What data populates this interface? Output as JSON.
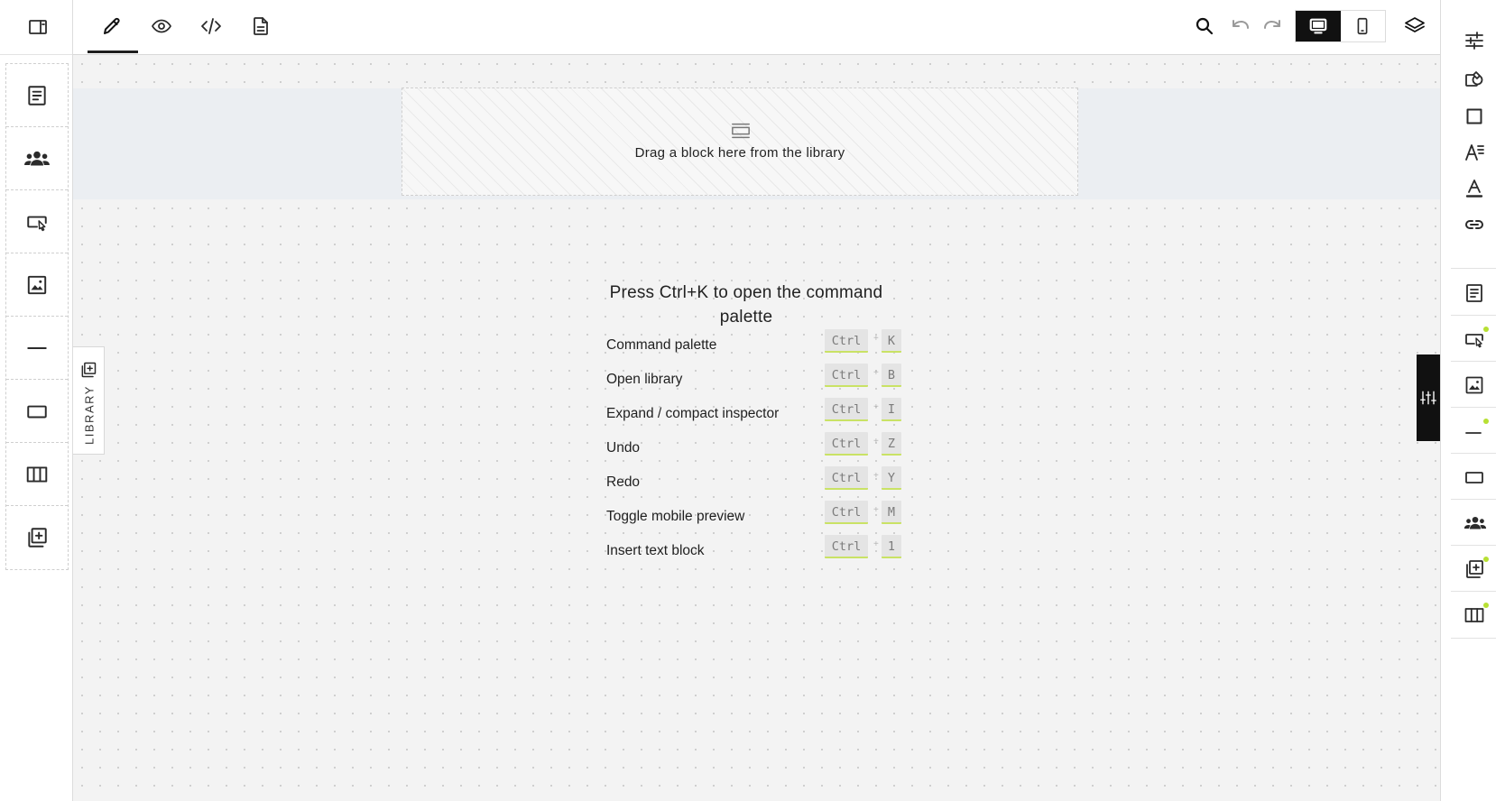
{
  "toolbar": {
    "tabs": [
      {
        "id": "edit",
        "icon": "pencil-icon",
        "active": true
      },
      {
        "id": "preview",
        "icon": "eye-icon",
        "active": false
      },
      {
        "id": "code",
        "icon": "code-icon",
        "active": false
      },
      {
        "id": "document",
        "icon": "document-icon",
        "active": false
      }
    ],
    "tools": [
      "search-icon",
      "undo-icon",
      "redo-icon"
    ],
    "device_modes": [
      {
        "id": "desktop",
        "icon": "desktop-icon",
        "active": true
      },
      {
        "id": "mobile",
        "icon": "mobile-icon",
        "active": false
      }
    ],
    "layers_icon": "layers-icon"
  },
  "left_sidebar": {
    "toggle_icon": "sidebar-panel-icon",
    "blocks": [
      "text-block-icon",
      "group-block-icon",
      "button-block-icon",
      "image-block-icon",
      "divider-block-icon",
      "container-block-icon",
      "columns-block-icon",
      "add-block-icon"
    ]
  },
  "canvas": {
    "drop_zone_text": "Drag a block here from the library",
    "library_label": "LIBRARY"
  },
  "shortcuts": {
    "title": "Press Ctrl+K to open the command palette",
    "plus": "+",
    "items": [
      {
        "label": "Command palette",
        "modifier": "Ctrl",
        "key": "K"
      },
      {
        "label": "Open library",
        "modifier": "Ctrl",
        "key": "B"
      },
      {
        "label": "Expand / compact inspector",
        "modifier": "Ctrl",
        "key": "I"
      },
      {
        "label": "Undo",
        "modifier": "Ctrl",
        "key": "Z"
      },
      {
        "label": "Redo",
        "modifier": "Ctrl",
        "key": "Y"
      },
      {
        "label": "Toggle mobile preview",
        "modifier": "Ctrl",
        "key": "M"
      },
      {
        "label": "Insert text block",
        "modifier": "Ctrl",
        "key": "1"
      }
    ]
  },
  "right_sidebar": {
    "style_tools": [
      "sliders-icon",
      "fill-color-icon",
      "border-icon",
      "typography-icon",
      "text-color-icon",
      "link-icon"
    ],
    "blocks": [
      {
        "icon": "text-block-icon",
        "has_indicator": false
      },
      {
        "icon": "button-block-icon",
        "has_indicator": true
      },
      {
        "icon": "image-block-icon",
        "has_indicator": false
      },
      {
        "icon": "divider-block-icon",
        "has_indicator": true
      },
      {
        "icon": "container-block-icon",
        "has_indicator": false
      },
      {
        "icon": "group-block-icon",
        "has_indicator": false
      },
      {
        "icon": "add-block-icon",
        "has_indicator": true
      },
      {
        "icon": "columns-block-icon",
        "has_indicator": true
      }
    ],
    "indicator_color": "#b7e033"
  },
  "colors": {
    "accent": "#c9e265",
    "dark": "#111111",
    "canvas_bg": "#f3f3f3"
  }
}
